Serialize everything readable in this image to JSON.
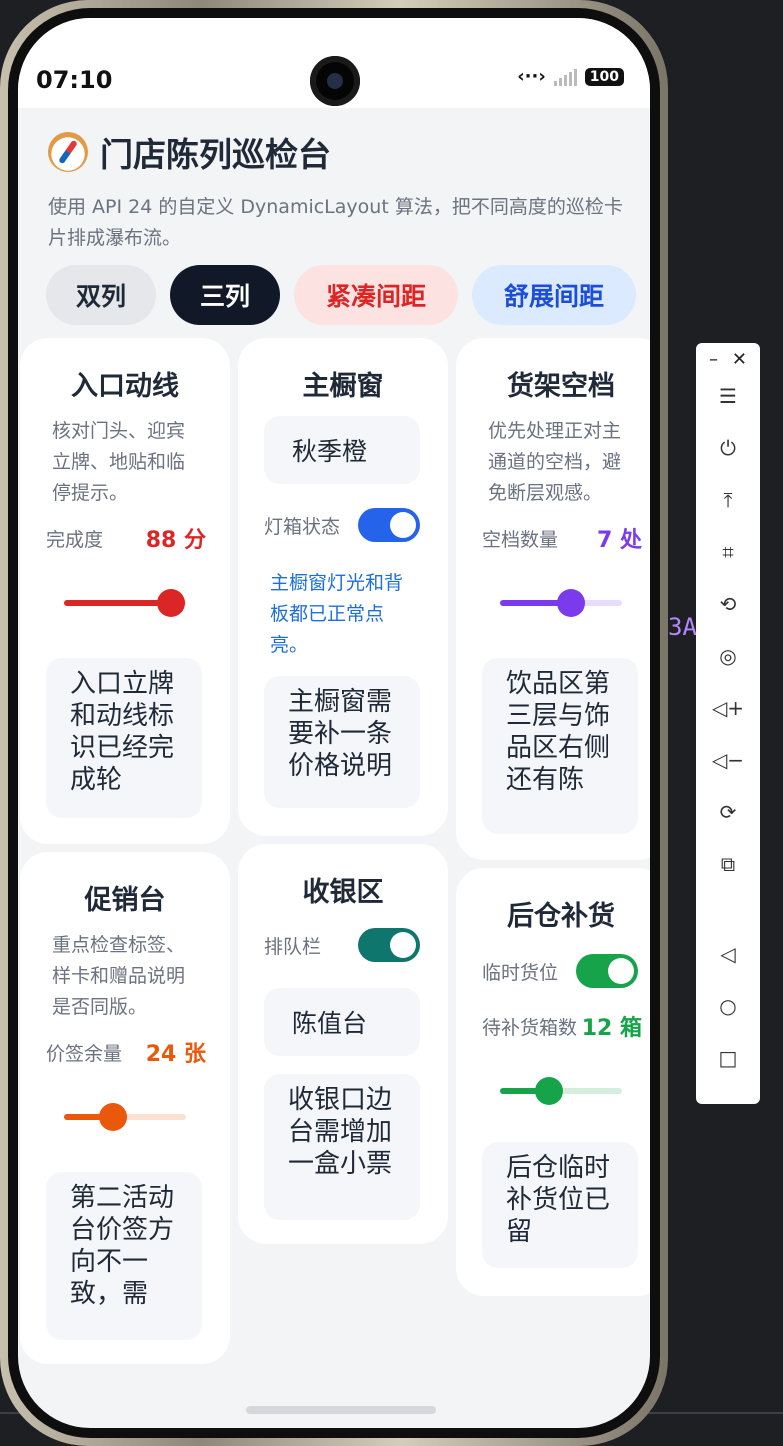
{
  "status_bar": {
    "time": "07:10",
    "battery": "100"
  },
  "header": {
    "title": "门店陈列巡检台",
    "subtitle": "使用 API 24 的自定义 DynamicLayout 算法，把不同高度的巡检卡片排成瀑布流。"
  },
  "chips": [
    {
      "label": "双列",
      "bg": "#e5e7eb",
      "fg": "#1f2937"
    },
    {
      "label": "三列",
      "bg": "#111827",
      "fg": "#ffffff"
    },
    {
      "label": "紧凑间距",
      "bg": "#fde2e2",
      "fg": "#dc2626"
    },
    {
      "label": "舒展间距",
      "bg": "#dbeafe",
      "fg": "#1d4ed8"
    }
  ],
  "cards": {
    "entrance": {
      "title": "入口动线",
      "desc": "核对门头、迎宾立牌、地贴和临停提示。",
      "metric_label": "完成度",
      "metric_value": "88 分",
      "metric_color": "#dc2626",
      "slider_fraction": 0.88,
      "note": "入口立牌和动线标识已经完成轮"
    },
    "window": {
      "title": "主橱窗",
      "chip": "秋季橙",
      "toggle_label": "灯箱状态",
      "toggle_on": true,
      "toggle_color": "#2563eb",
      "status_text": "主橱窗灯光和背板都已正常点亮。",
      "note": "主橱窗需要补一条价格说明"
    },
    "shelf": {
      "title": "货架空档",
      "desc": "优先处理正对主通道的空档，避免断层观感。",
      "metric_label": "空档数量",
      "metric_value": "7 处",
      "metric_color": "#7c3aed",
      "slider_fraction": 0.58,
      "note": "饮品区第三层与饰品区右侧还有陈"
    },
    "promo": {
      "title": "促销台",
      "desc": "重点检查标签、样卡和赠品说明是否同版。",
      "metric_label": "价签余量",
      "metric_value": "24 张",
      "metric_color": "#ea580c",
      "slider_fraction": 0.4,
      "note": "第二活动台价签方向不一致，需"
    },
    "cashier": {
      "title": "收银区",
      "toggle_label": "排队栏",
      "toggle_on": true,
      "toggle_color": "#0f766e",
      "chip": "陈值台",
      "note": "收银口边台需增加一盒小票"
    },
    "backroom": {
      "title": "后仓补货",
      "toggle_label": "临时货位",
      "toggle_on": true,
      "toggle_color": "#16a34a",
      "metric_label": "待补货箱数",
      "metric_value": "12 箱",
      "metric_color": "#16a34a",
      "slider_fraction": 0.4,
      "note": "后仓临时补货位已留"
    }
  },
  "emulator_toolbar": {
    "items": [
      "menu-icon",
      "power-icon",
      "pin-top-icon",
      "crop-icon",
      "rotate-icon",
      "screenshot-icon",
      "volume-up-icon",
      "volume-down-icon",
      "rotate-device-icon",
      "multi-window-icon",
      "back-icon",
      "home-icon",
      "recents-icon"
    ]
  },
  "ide_fragment": "3A"
}
